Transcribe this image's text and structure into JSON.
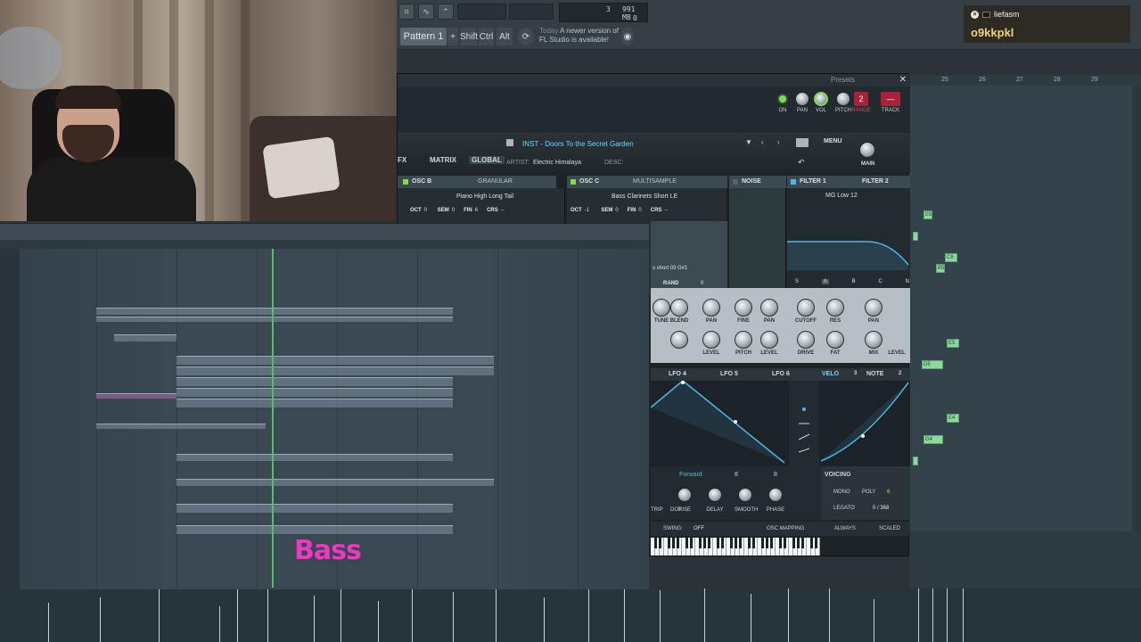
{
  "chat": {
    "username": "liefasm",
    "message": "o9kkpkl"
  },
  "toolbar": {
    "pattern_label": "Pattern 1",
    "add_pattern": "+",
    "shift_label": "Shift",
    "ctrl_label": "Ctrl",
    "alt_label": "Alt",
    "update_when": "Today",
    "update_text_1": "A newer version of",
    "update_text_2": "FL Studio is available!",
    "cpu_count": "3",
    "memory": "991 MB",
    "polyphony": "0"
  },
  "serum": {
    "presets_label": "Presets",
    "track_label": "TRACK",
    "track_number": "2",
    "wrapper_knobs": [
      "ON",
      "PAN",
      "VOL",
      "PITCH",
      "RANGE"
    ],
    "tabs": [
      "FX",
      "MATRIX",
      "GLOBAL"
    ],
    "preset_name": "INST - Doors To the Secret Garden",
    "artist_label": "ARTIST:",
    "artist": "Electric Himalaya",
    "desc_label": "DESC:",
    "menu_label": "MENU",
    "main_label": "MAIN",
    "osc_b": {
      "title": "OSC B",
      "mode": "GRANULAR",
      "wavetable": "Piano High Long Tail",
      "oct_label": "OCT",
      "oct": "0",
      "sem_label": "SEM",
      "sem": "0",
      "fin_label": "FIN",
      "fin": "6",
      "crs_label": "CRS",
      "crs": "--"
    },
    "osc_c": {
      "title": "OSC C",
      "mode": "MULTISAMPLE",
      "wavetable": "Bass Clarinets Short LE",
      "oct_label": "OCT",
      "oct": "-1",
      "sem_label": "SEM",
      "sem": "0",
      "fin_label": "FIN",
      "fin": "0",
      "crs_label": "CRS",
      "crs": "--",
      "sample_label": "s short 03 G#1",
      "rand_label": "RAND",
      "rand": "0"
    },
    "noise_label": "NOISE",
    "filter1_label": "FILTER 1",
    "filter2_label": "FILTER 2",
    "filter_type": "MG Low 12",
    "filter_routing": [
      "S",
      "A",
      "B",
      "C",
      "N"
    ],
    "knob_labels_top": [
      "TUNE",
      "BLEND",
      "PAN",
      "FINE",
      "PAN",
      "CUTOFF",
      "RES",
      "PAN"
    ],
    "knob_labels_bottom": [
      "LEVEL",
      "PITCH",
      "LEVEL",
      "DRIVE",
      "FAT",
      "MIX",
      "LEVEL"
    ],
    "lfo_tabs": [
      "LFO 4",
      "LFO 5",
      "LFO 6",
      "VELO",
      "NOTE"
    ],
    "velo_number": "3",
    "note_number": "2",
    "lfo_mode": "Forward",
    "lfo_grid_1": "8",
    "lfo_grid_2": "8",
    "lfo_knobs": [
      "DOT",
      "RISE",
      "DELAY",
      "SMOOTH",
      "PHASE"
    ],
    "lfo_trip": "TRIP",
    "voicing_label": "VOICING",
    "mono_label": "MONO",
    "poly_label": "POLY",
    "poly_value": "6",
    "legato_label": "LEGATO",
    "legato_value": "0 / 368",
    "swing_label": "SWING:",
    "swing_value": "OFF",
    "osc_mapping_label": "OSC MAPPING",
    "always_label": "ALWAYS",
    "scaled_label": "SCALED"
  },
  "pianoroll": {
    "ruler_numbers": [
      "25",
      "26",
      "27",
      "28",
      "29"
    ],
    "notes": [
      "E5",
      "C6",
      "B5",
      "E5",
      "D5",
      "E4",
      "G4"
    ]
  },
  "caption": "Bass"
}
